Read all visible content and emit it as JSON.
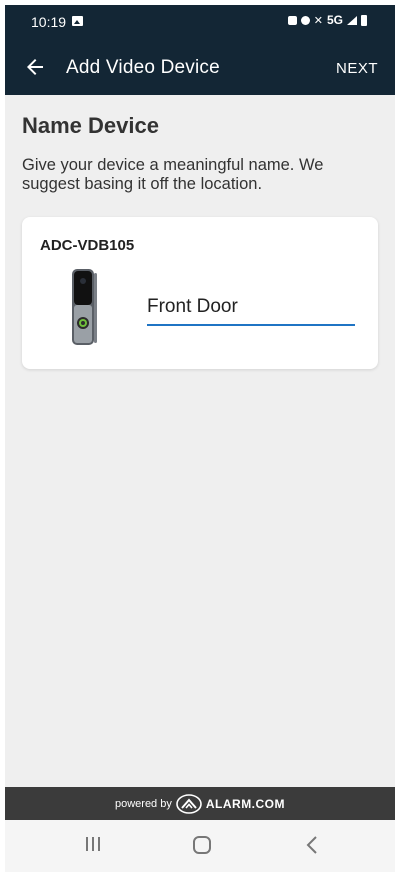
{
  "status_bar": {
    "time": "10:19",
    "network": "5G",
    "icons": [
      "gallery-icon",
      "lock-icon",
      "alarm-icon",
      "mute-icon",
      "signal-icon",
      "battery-icon"
    ]
  },
  "app_bar": {
    "title": "Add Video Device",
    "next_label": "NEXT"
  },
  "main": {
    "heading": "Name Device",
    "description": "Give your device a meaningful name. We suggest basing it off the location."
  },
  "device_card": {
    "model": "ADC-VDB105",
    "name_value": "Front Door"
  },
  "footer": {
    "powered_by": "powered by",
    "brand": "ALARM.COM"
  },
  "colors": {
    "app_bar": "#132635",
    "background": "#efefef",
    "input_underline": "#1f74c4",
    "footer": "#3b3b3b"
  }
}
